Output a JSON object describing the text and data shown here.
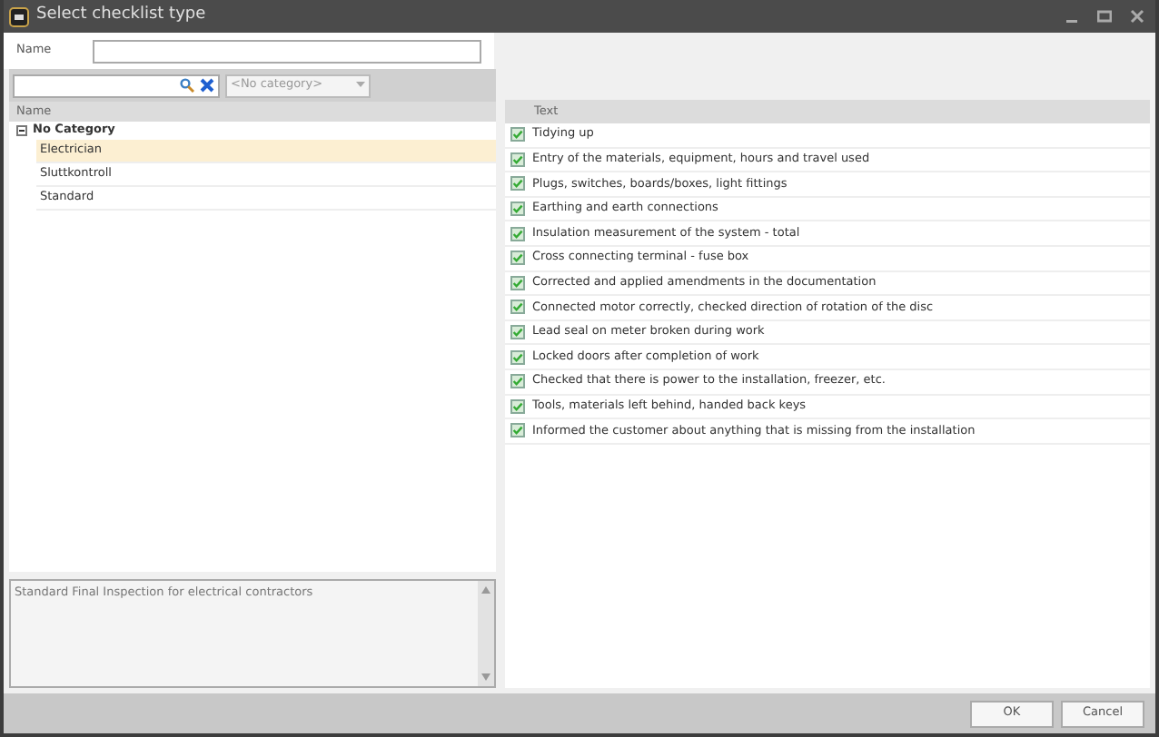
{
  "window": {
    "title": "Select checklist type"
  },
  "name_field": {
    "label": "Name"
  },
  "filter": {
    "category_placeholder": "<No category>"
  },
  "tree": {
    "column": "Name",
    "groups": [
      {
        "label": "No Category",
        "expanded": true,
        "children": [
          {
            "label": "Electrician",
            "selected": true
          },
          {
            "label": "Sluttkontroll",
            "selected": false
          },
          {
            "label": "Standard",
            "selected": false
          }
        ]
      }
    ]
  },
  "description": "Standard Final Inspection for electrical contractors",
  "checklist": {
    "column": "Text",
    "items": [
      {
        "text": "Tidying up",
        "checked": true
      },
      {
        "text": "Entry of the materials, equipment, hours and travel used",
        "checked": true
      },
      {
        "text": "Plugs, switches, boards/boxes, light fittings",
        "checked": true
      },
      {
        "text": "Earthing and earth connections",
        "checked": true
      },
      {
        "text": "Insulation measurement of the system - total",
        "checked": true
      },
      {
        "text": "Cross connecting terminal - fuse box",
        "checked": true
      },
      {
        "text": "Corrected and applied amendments in the documentation",
        "checked": true
      },
      {
        "text": "Connected motor correctly, checked direction of rotation of the disc",
        "checked": true
      },
      {
        "text": "Lead seal on meter broken during work",
        "checked": true
      },
      {
        "text": "Locked doors after completion of work",
        "checked": true
      },
      {
        "text": "Checked that there is power to the installation, freezer, etc.",
        "checked": true
      },
      {
        "text": "Tools, materials left behind, handed back keys",
        "checked": true
      },
      {
        "text": "Informed the customer about anything that is missing from the installation",
        "checked": true
      }
    ]
  },
  "buttons": [
    "OK",
    "Cancel"
  ]
}
